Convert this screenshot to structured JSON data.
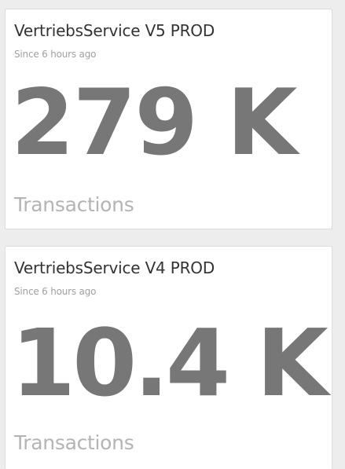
{
  "widgets": [
    {
      "title": "VertriebsService V5 PROD",
      "subtitle": "Since 6 hours ago",
      "value": "279 K",
      "unit": "Transactions"
    },
    {
      "title": "VertriebsService V4 PROD",
      "subtitle": "Since 6 hours ago",
      "value": "10.4 K",
      "unit": "Transactions"
    }
  ],
  "colors": {
    "background": "#ededed",
    "card": "#ffffff",
    "title": "#333333",
    "subtitle": "#a0a0a0",
    "value": "#777777",
    "unit": "#b4b4b4"
  }
}
